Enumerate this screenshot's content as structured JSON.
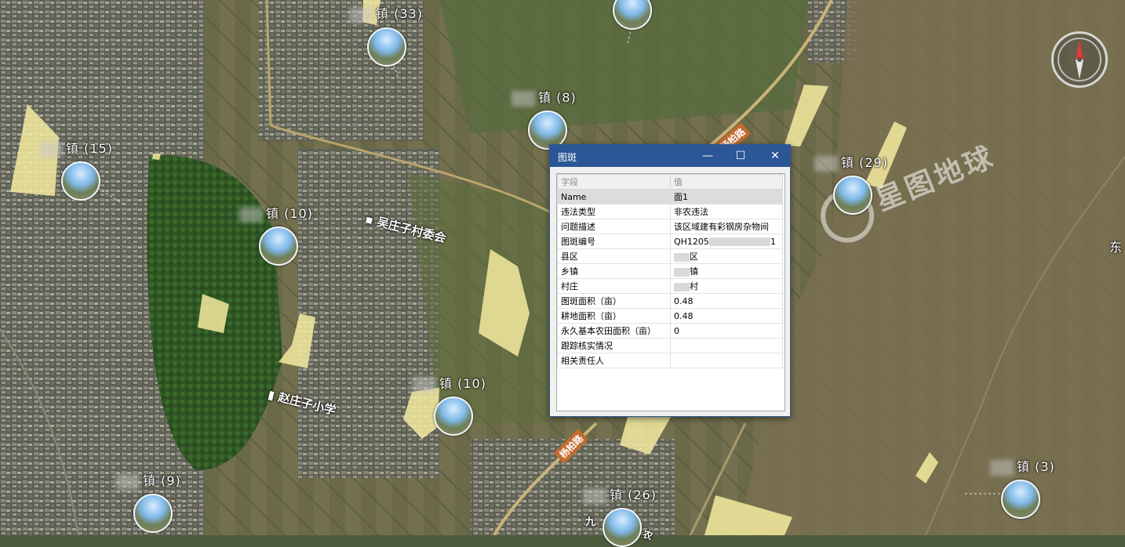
{
  "markers": [
    {
      "label": "镇",
      "count": "(33)"
    },
    {
      "label": "镇",
      "count": "(8)"
    },
    {
      "label": "镇",
      "count": "(15)"
    },
    {
      "label": "镇",
      "count": "(10)"
    },
    {
      "label": "镇",
      "count": "(29)"
    },
    {
      "label": "镇",
      "count": "(10)"
    },
    {
      "label": "镇",
      "count": "(9)"
    },
    {
      "label": "镇",
      "count": "(26)"
    },
    {
      "label": "镇",
      "count": "(3)"
    }
  ],
  "pois": {
    "village_committee": "吴庄子村委会",
    "school": "赵庄子小学",
    "edge_text": "东",
    "bottom_poi": "九",
    "bottom_poi2": "农"
  },
  "road_labels": [
    "杨柏路",
    "杨柏路"
  ],
  "watermark": "星图地球",
  "colors": {
    "polygon_fill": "#f5eba0",
    "dialog_title": "#2b5797"
  },
  "dialog": {
    "title": "图斑",
    "controls": {
      "minimize": "—",
      "maximize": "☐",
      "close": "✕"
    },
    "headers": {
      "field": "字段",
      "value": "值"
    },
    "rows": [
      {
        "field": "Name",
        "value": "面1"
      },
      {
        "field": "违法类型",
        "value": "非农违法"
      },
      {
        "field": "问题描述",
        "value": "该区域建有彩钢房杂物间"
      },
      {
        "field": "图斑编号",
        "value": "QH1205",
        "suffix": "1"
      },
      {
        "field": "县区",
        "value": "",
        "suffix": "区"
      },
      {
        "field": "乡镇",
        "value": "",
        "suffix": "镇"
      },
      {
        "field": "村庄",
        "value": "",
        "suffix": "村"
      },
      {
        "field": "图斑面积（亩）",
        "value": "0.48"
      },
      {
        "field": "耕地面积（亩）",
        "value": "0.48"
      },
      {
        "field": "永久基本农田面积（亩）",
        "value": "0"
      },
      {
        "field": "跟踪核实情况",
        "value": ""
      },
      {
        "field": "相关责任人",
        "value": ""
      }
    ]
  }
}
